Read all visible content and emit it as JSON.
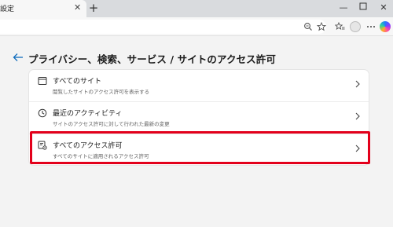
{
  "tab": {
    "title": "設定"
  },
  "page": {
    "title": "プライバシー、検索、サービス / サイトのアクセス許可"
  },
  "rows": [
    {
      "label": "すべてのサイト",
      "description": "閲覧したサイトのアクセス許可を表示する"
    },
    {
      "label": "最近のアクティビティ",
      "description": "サイトのアクセス許可に対して行われた最新の変更"
    },
    {
      "label": "すべてのアクセス許可",
      "description": "すべてのサイトに適用されるアクセス許可"
    }
  ],
  "colors": {
    "highlight": "#e3001b",
    "accent": "#0f6cbd"
  },
  "icons": [
    "close-icon",
    "plus-icon",
    "minimize-icon",
    "maximize-icon",
    "window-close-icon",
    "zoom-icon",
    "favorite-star-icon",
    "favorites-icon",
    "profile-icon",
    "copilot-icon",
    "back-arrow-icon",
    "site-window-icon",
    "clock-icon",
    "permissions-icon",
    "chevron-right-icon"
  ]
}
